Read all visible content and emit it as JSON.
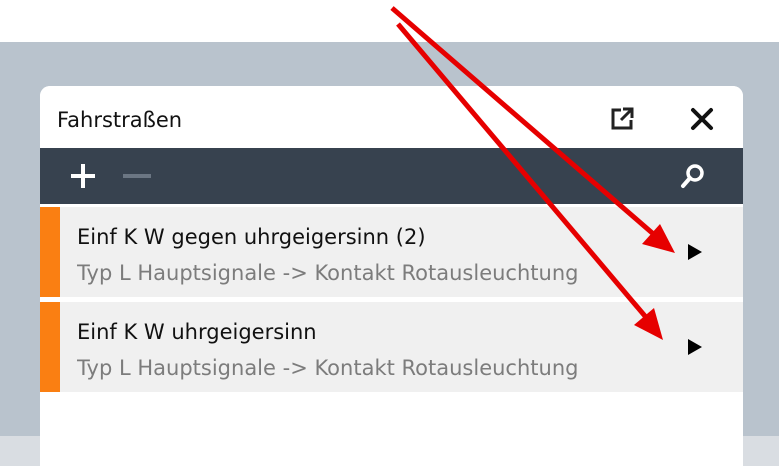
{
  "panel": {
    "title": "Fahrstraßen"
  },
  "toolbar": {
    "icons": [
      "plus-icon",
      "minus-icon",
      "search-icon"
    ]
  },
  "routes": [
    {
      "name": "Einf K W gegen uhrgeigersinn (2)",
      "description": "Typ L Hauptsignale -> Kontakt Rotausleuchtung"
    },
    {
      "name": "Einf K W uhrgeigersinn",
      "description": "Typ L Hauptsignale -> Kontakt Rotausleuchtung"
    }
  ],
  "colors": {
    "accent": "#fa7f12",
    "toolbar": "#37424f",
    "annotation": "#e60000"
  }
}
